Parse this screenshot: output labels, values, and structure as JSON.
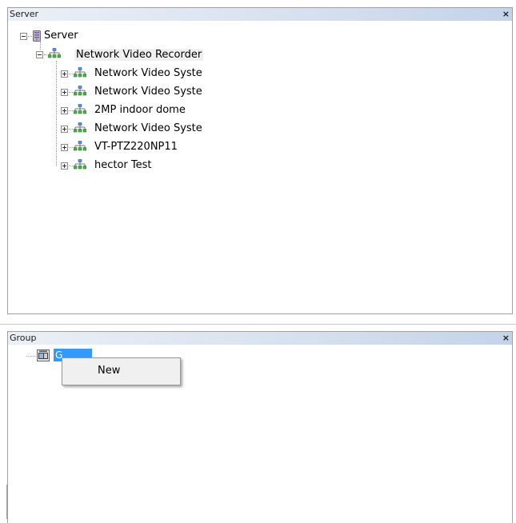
{
  "server_panel": {
    "title": "Server",
    "close_glyph": "×",
    "root": {
      "label": "Server",
      "icon": "server-icon"
    },
    "recorder": {
      "label": "Network Video Recorder",
      "icon": "network-icon"
    },
    "children": [
      {
        "label": "Network Video Syste",
        "icon": "network-icon"
      },
      {
        "label": "Network Video Syste",
        "icon": "network-icon"
      },
      {
        "label": "2MP indoor dome",
        "icon": "network-icon"
      },
      {
        "label": "Network Video Syste",
        "icon": "network-icon"
      },
      {
        "label": "VT-PTZ220NP11",
        "icon": "network-icon"
      },
      {
        "label": "hector Test",
        "icon": "network-icon"
      }
    ]
  },
  "group_panel": {
    "title": "Group",
    "close_glyph": "×",
    "root": {
      "label": "G",
      "icon": "camera-group-icon"
    }
  },
  "context_menu": {
    "items": [
      {
        "label": "New"
      }
    ]
  },
  "colors": {
    "selection": "#3399ff",
    "titlebar_start": "#ecf0f6",
    "titlebar_end": "#c3d3e9"
  }
}
